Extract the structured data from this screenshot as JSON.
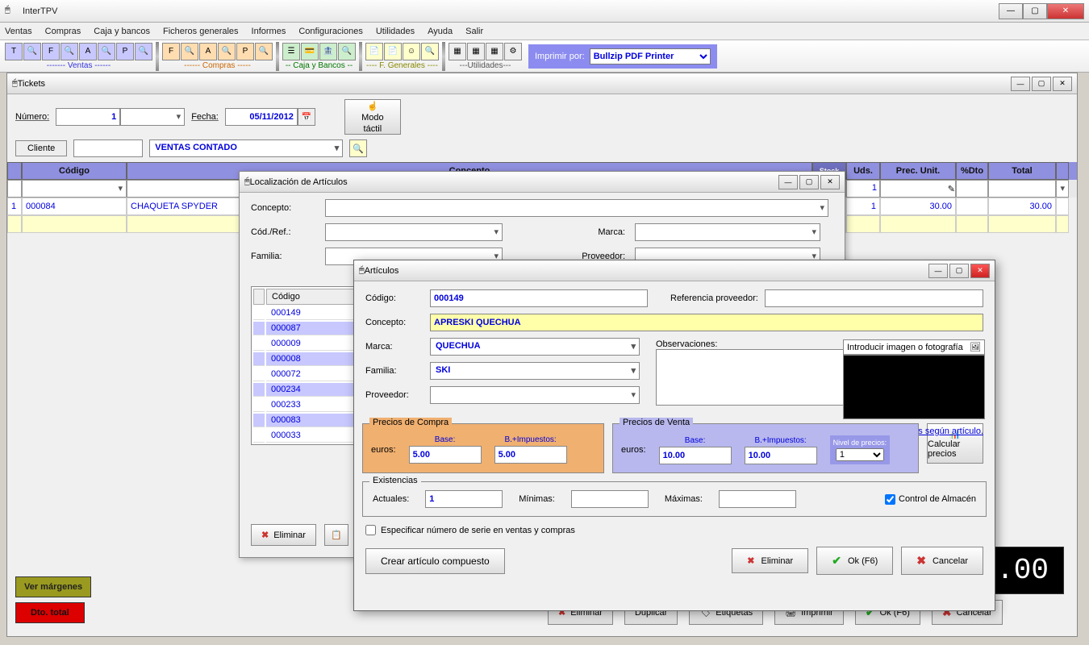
{
  "app": {
    "title": "InterTPV"
  },
  "menu": [
    "Ventas",
    "Compras",
    "Caja y bancos",
    "Ficheros generales",
    "Informes",
    "Configuraciones",
    "Utilidades",
    "Ayuda",
    "Salir"
  ],
  "toolbar": {
    "ventas_label": "------- Ventas ------",
    "compras_label": "------ Compras -----",
    "caja_label": "-- Caja y Bancos --",
    "fgen_label": "---- F. Generales ----",
    "util_label": "---Utilidades---",
    "print_label": "Imprimir por:",
    "printer": "Bullzip PDF Printer"
  },
  "tickets": {
    "title": "Tickets",
    "numero_label": "Número:",
    "numero": "1",
    "fecha_label": "Fecha:",
    "fecha": "05/11/2012",
    "modo_label1": "Modo",
    "modo_label2": "táctil",
    "cliente_label": "Cliente",
    "cliente_combo": "VENTAS CONTADO",
    "columns": {
      "codigo": "Código",
      "concepto": "Concepto",
      "stock": "Stock",
      "uds": "Uds.",
      "pu": "Prec. Unit.",
      "dto": "%Dto",
      "total": "Total"
    },
    "filter_uds": "1",
    "row": {
      "n": "1",
      "codigo": "000084",
      "concepto": "CHAQUETA SPYDER",
      "uds": "1",
      "pu": "30.00",
      "total": "30.00"
    },
    "btn_margen": "Ver márgenes",
    "btn_dtotot": "Dto. total",
    "total_display": ".00",
    "foot": {
      "eliminar": "Eliminar",
      "duplicar": "Duplicar",
      "etiquetas": "Etiquetas",
      "imprimir": "Imprimir",
      "ok": "Ok (F6)",
      "cancelar": "Cancelar"
    }
  },
  "loc": {
    "title": "Localización de Artículos",
    "concepto_label": "Concepto:",
    "codref_label": "Cód./Ref.:",
    "marca_label": "Marca:",
    "familia_label": "Familia:",
    "proveedor_label": "Proveedor:",
    "col_codigo": "Código",
    "rows": [
      "000149",
      "000087",
      "000009",
      "000008",
      "000072",
      "000234",
      "000233",
      "000083",
      "000033"
    ],
    "selected": [
      1,
      3,
      5,
      7
    ],
    "btn_eliminar": "Eliminar"
  },
  "art": {
    "title": "Artículos",
    "codigo_label": "Código:",
    "codigo": "000149",
    "refprov_label": "Referencia proveedor:",
    "concepto_label": "Concepto:",
    "concepto": "APRESKI QUECHUA",
    "marca_label": "Marca:",
    "marca": "QUECHUA",
    "familia_label": "Familia:",
    "familia": "SKI",
    "proveedor_label": "Proveedor:",
    "observ_label": "Observaciones:",
    "img_label": "Introducir imagen o fotografía",
    "tax_link": "Pulse aquí para configurar distintos impuestos según artículo.",
    "compra": {
      "legend": "Precios de Compra",
      "base_label": "Base:",
      "imp_label": "B.+Impuestos:",
      "euros_label": "euros:",
      "base": "5.00",
      "imp": "5.00"
    },
    "venta": {
      "legend": "Precios de Venta",
      "base_label": "Base:",
      "imp_label": "B.+Impuestos:",
      "euros_label": "euros:",
      "base": "10.00",
      "imp": "10.00",
      "nivel_label": "Nivel de precios:",
      "nivel": "1"
    },
    "calc_label": "Calcular precios",
    "exist": {
      "legend": "Existencias",
      "act_label": "Actuales:",
      "act": "1",
      "min_label": "Mínimas:",
      "max_label": "Máximas:",
      "control_label": "Control de Almacén"
    },
    "serie_label": "Especificar número de serie en ventas y compras",
    "crear_label": "Crear artículo compuesto",
    "eliminar": "Eliminar",
    "ok": "Ok (F6)",
    "cancelar": "Cancelar"
  }
}
